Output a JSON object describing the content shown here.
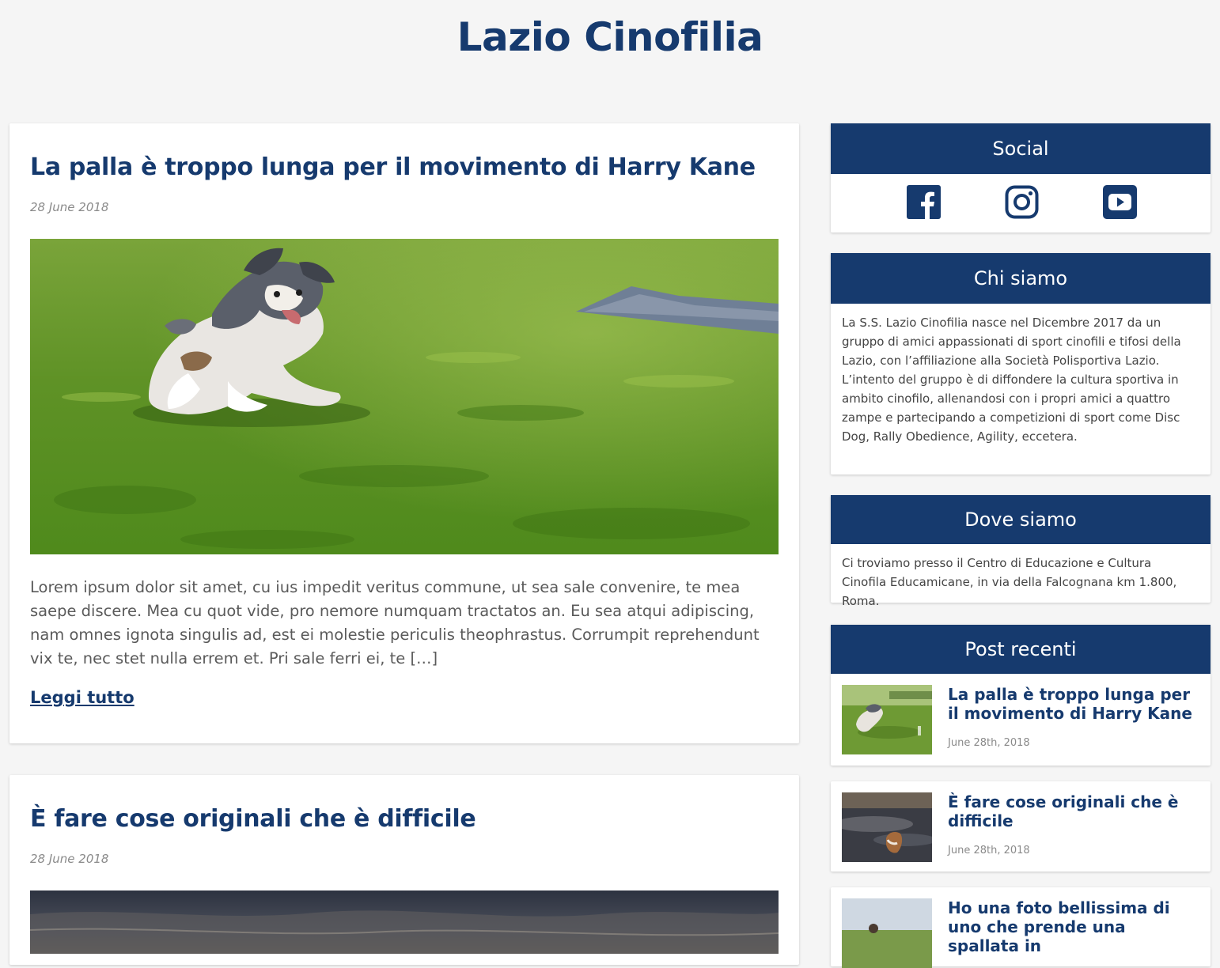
{
  "site": {
    "title": "Lazio Cinofilia"
  },
  "posts": [
    {
      "title": "La palla è troppo lunga per il movimento di Harry Kane",
      "date": "28 June 2018",
      "excerpt": "Lorem ipsum dolor sit amet, cu ius impedit veritus commune, ut sea sale convenire, te mea saepe discere. Mea cu quot vide, pro nemore numquam tractatos an. Eu sea atqui adipiscing, nam omnes ignota singulis ad, est ei molestie periculis theophrastus. Corrumpit reprehendunt vix te, nec stet nulla errem et. Pri sale ferri ei, te […]",
      "read_more": "Leggi tutto"
    },
    {
      "title": "È fare cose originali che è difficile",
      "date": "28 June 2018"
    }
  ],
  "sidebar": {
    "social": {
      "title": "Social",
      "icons": [
        "facebook-icon",
        "instagram-icon",
        "youtube-icon"
      ]
    },
    "chi_siamo": {
      "title": "Chi siamo",
      "text": "La S.S. Lazio Cinofilia nasce nel Dicembre 2017 da un gruppo di amici appassionati di sport cinofili e tifosi della Lazio, con l’affiliazione alla Società Polisportiva Lazio. L’intento del gruppo è di diffondere la cultura sportiva in ambito cinofilo, allenandosi con i propri amici a quattro zampe e partecipando a competizioni di sport come Disc Dog, Rally Obedience, Agility, eccetera."
    },
    "dove_siamo": {
      "title": "Dove siamo",
      "text": "Ci troviamo presso il Centro di Educazione e Cultura Cinofila Educamicane, in via della Falcognana km 1.800, Roma."
    },
    "post_recenti": {
      "title": "Post recenti",
      "items": [
        {
          "title": "La palla è troppo lunga per il movimento di Harry Kane",
          "date": "June 28th, 2018"
        },
        {
          "title": "È fare cose originali che è difficile",
          "date": "June 28th, 2018"
        },
        {
          "title": "Ho una foto bellissima di uno che prende una spallata in",
          "date": ""
        }
      ]
    }
  },
  "colors": {
    "brand": "#163a6e",
    "background": "#f5f5f5",
    "card": "#ffffff",
    "muted": "#8a8a8a"
  }
}
